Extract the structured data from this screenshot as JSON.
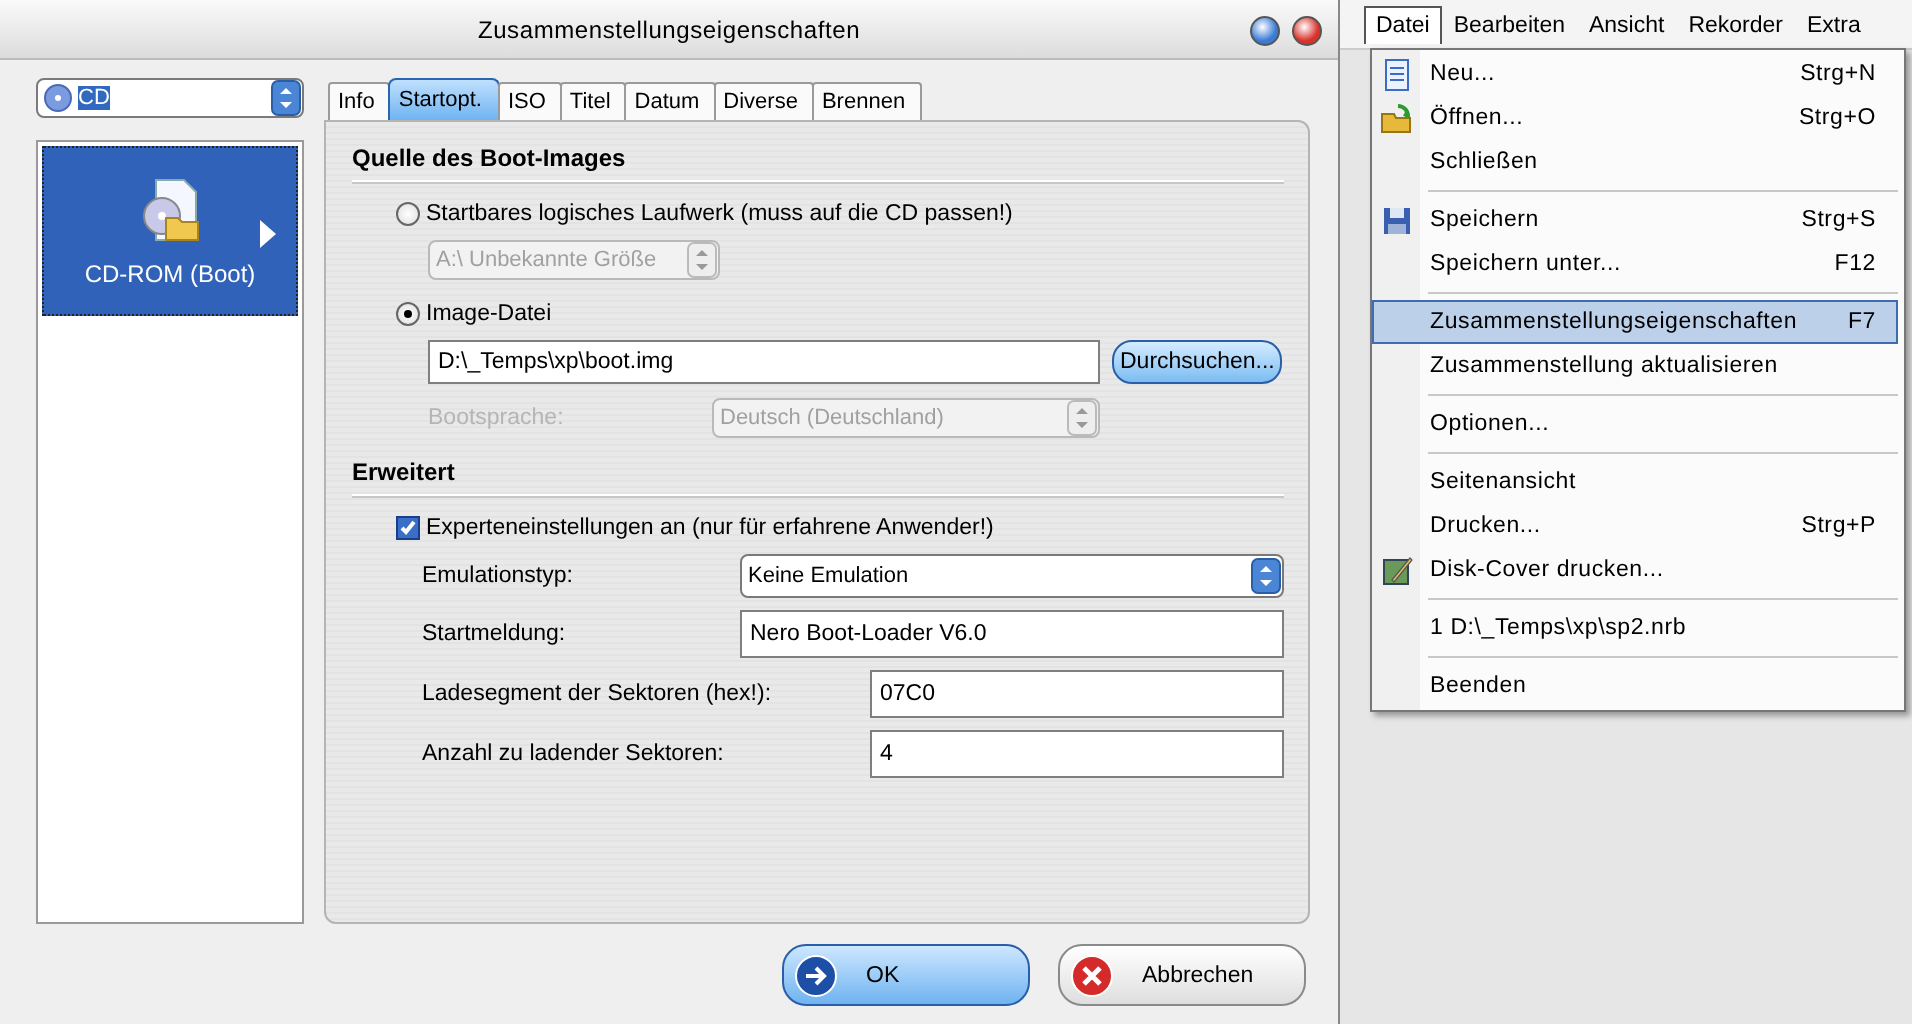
{
  "dialog": {
    "title": "Zusammenstellungseigenschaften",
    "drive_select": {
      "value": "CD"
    },
    "sidebar": {
      "items": [
        {
          "label": "CD-ROM (Boot)",
          "selected": true
        }
      ]
    },
    "tabs": [
      {
        "label": "Info",
        "selected": false
      },
      {
        "label": "Startopt.",
        "selected": true
      },
      {
        "label": "ISO",
        "selected": false
      },
      {
        "label": "Titel",
        "selected": false
      },
      {
        "label": "Datum",
        "selected": false
      },
      {
        "label": "Diverse",
        "selected": false
      },
      {
        "label": "Brennen",
        "selected": false
      }
    ],
    "boot_source": {
      "heading": "Quelle des Boot-Images",
      "drive_option": {
        "label": "Startbares logisches Laufwerk (muss auf die CD passen!)",
        "selected": false
      },
      "drive_value": {
        "value": "A:\\  Unbekannte Größe",
        "disabled": true
      },
      "image_option": {
        "label": "Image-Datei",
        "selected": true
      },
      "image_path": {
        "value": "D:\\_Temps\\xp\\boot.img"
      },
      "browse_button": "Durchsuchen...",
      "language_label": {
        "text": "Bootsprache:",
        "disabled": true
      },
      "language_value": {
        "value": "Deutsch (Deutschland)",
        "disabled": true
      }
    },
    "advanced": {
      "heading": "Erweitert",
      "expert": {
        "label": "Experteneinstellungen an (nur für erfahrene Anwender!)",
        "checked": true
      },
      "fields": [
        {
          "kind": "select",
          "label": "Emulationstyp:",
          "value": "Keine Emulation"
        },
        {
          "kind": "text",
          "label": "Startmeldung:",
          "value": "Nero Boot-Loader V6.0"
        },
        {
          "kind": "short",
          "label": "Ladesegment der Sektoren (hex!):",
          "value": "07C0"
        },
        {
          "kind": "short",
          "label": "Anzahl zu ladender Sektoren:",
          "value": "4"
        }
      ]
    },
    "buttons": [
      {
        "kind": "ok",
        "label": "OK"
      },
      {
        "kind": "cancel",
        "label": "Abbrechen"
      }
    ]
  },
  "menubar": [
    {
      "label": "Datei",
      "selected": true
    },
    {
      "label": "Bearbeiten",
      "selected": false
    },
    {
      "label": "Ansicht",
      "selected": false
    },
    {
      "label": "Rekorder",
      "selected": false
    },
    {
      "label": "Extra",
      "selected": false
    }
  ],
  "menu": [
    {
      "kind": "item",
      "label": "Neu...",
      "shortcut": "Strg+N",
      "icon": true,
      "selected": false
    },
    {
      "kind": "item",
      "label": "Öffnen...",
      "shortcut": "Strg+O",
      "icon": true,
      "selected": false
    },
    {
      "kind": "item",
      "label": "Schließen",
      "selected": false
    },
    {
      "kind": "separator"
    },
    {
      "kind": "item",
      "label": "Speichern",
      "shortcut": "Strg+S",
      "icon": true,
      "selected": false
    },
    {
      "kind": "item",
      "label": "Speichern unter...",
      "shortcut": "F12",
      "selected": false
    },
    {
      "kind": "separator"
    },
    {
      "kind": "item",
      "label": "Zusammenstellungseigenschaften",
      "shortcut": "F7",
      "selected": true
    },
    {
      "kind": "item",
      "label": "Zusammenstellung aktualisieren",
      "selected": false
    },
    {
      "kind": "separator"
    },
    {
      "kind": "item",
      "label": "Optionen...",
      "selected": false
    },
    {
      "kind": "separator"
    },
    {
      "kind": "item",
      "label": "Seitenansicht",
      "selected": false
    },
    {
      "kind": "item",
      "label": "Drucken...",
      "shortcut": "Strg+P",
      "selected": false
    },
    {
      "kind": "item",
      "label": "Disk-Cover drucken...",
      "icon": true,
      "selected": false
    },
    {
      "kind": "separator"
    },
    {
      "kind": "item",
      "label": "1 D:\\_Temps\\xp\\sp2.nrb",
      "selected": false
    },
    {
      "kind": "separator"
    },
    {
      "kind": "item",
      "label": "Beenden",
      "selected": false
    }
  ]
}
